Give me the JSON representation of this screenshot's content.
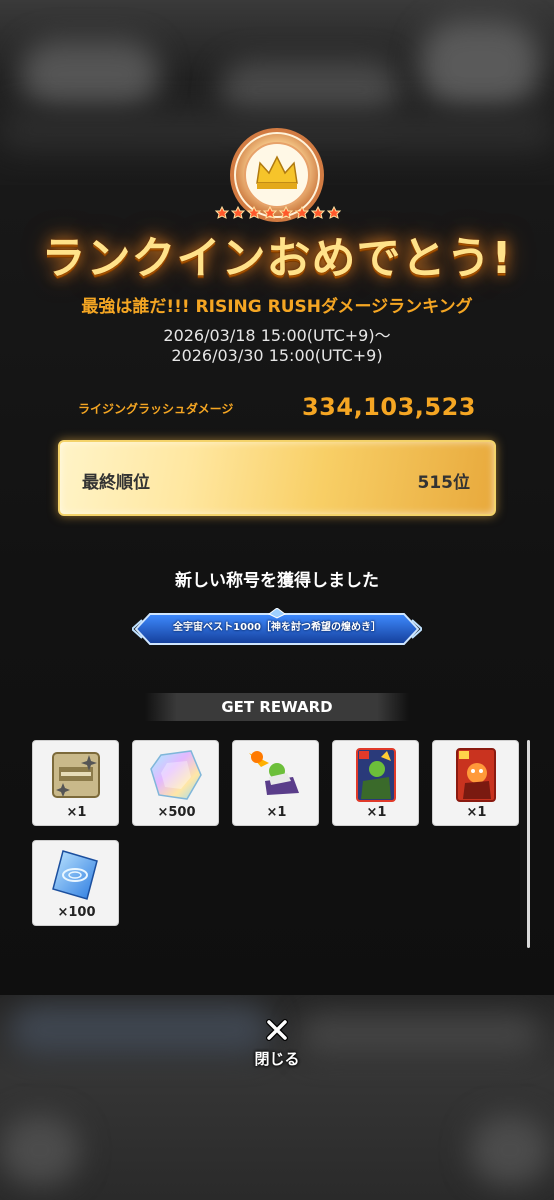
{
  "header": {
    "congrats": "ランクインおめでとう!",
    "event_title": "最強は誰だ!!! RISING RUSHダメージランキング",
    "period_start": "2026/03/18 15:00(UTC+9)～",
    "period_end": "2026/03/30 15:00(UTC+9)"
  },
  "score": {
    "label": "ライジングラッシュダメージ",
    "value": "334,103,523"
  },
  "rank": {
    "label": "最終順位",
    "value": "515位"
  },
  "title_award": {
    "message": "新しい称号を獲得しました",
    "title_text": "全宇宙ベスト1000［神を討つ希望の煌めき］"
  },
  "rewards": {
    "header": "GET REWARD",
    "items": [
      {
        "icon": "ticket-icon",
        "qty": "×1"
      },
      {
        "icon": "crystal-icon",
        "qty": "×500"
      },
      {
        "icon": "character-icon",
        "qty": "×1"
      },
      {
        "icon": "card-icon",
        "qty": "×1"
      },
      {
        "icon": "card-icon",
        "qty": "×1"
      },
      {
        "icon": "memory-icon",
        "qty": "×100"
      }
    ]
  },
  "close": {
    "label": "閉じる"
  },
  "colors": {
    "accent": "#f5a623",
    "gold": "#f4d36a"
  }
}
